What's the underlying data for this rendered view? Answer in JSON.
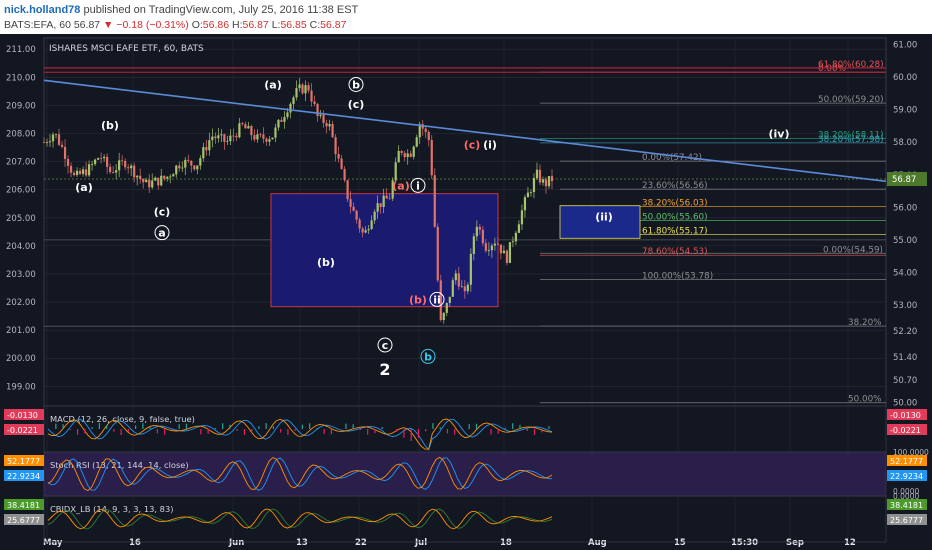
{
  "header": {
    "user": "nick.holland78",
    "published": "published on TradingView.com, July 25, 2016 11:38 EST",
    "symbol": "BATS:EFA, 60",
    "last": "56.87",
    "change": "−0.18 (−0.31%)",
    "open_label": "O:",
    "open": "56.86",
    "high_label": "H:",
    "high": "56.87",
    "low_label": "L:",
    "low": "56.85",
    "close_label": "C:",
    "close": "56.87"
  },
  "colors": {
    "background": "#131722",
    "grid": "#2a2e39",
    "text": "#b2b5be",
    "candle_up": "#a8c46b",
    "candle_down": "#e0736b",
    "trendline": "#5b8bd8",
    "box_fill": "#1a1a6e",
    "box_border": "#c8334b",
    "wave_red": "#ff6b6b",
    "wave_white": "#ffffff",
    "wave_cyan": "#39c6e6"
  },
  "chart_data": {
    "type": "candlestick",
    "title": "ISHARES MSCI EAFE ETF, 60, BATS",
    "left_axis": {
      "ticks": [
        "211.00",
        "210.00",
        "209.00",
        "208.00",
        "207.00",
        "206.00",
        "205.00",
        "204.00",
        "203.00",
        "202.00",
        "201.00",
        "200.00",
        "199.00"
      ],
      "range": [
        198.3,
        211.4
      ]
    },
    "right_axis": {
      "ticks": [
        "61.00",
        "60.00",
        "59.00",
        "58.00",
        "57.00",
        "56.00",
        "55.00",
        "54.00",
        "53.00",
        "52.20",
        "51.40",
        "50.70",
        "50.00"
      ],
      "range": [
        49.9,
        61.2
      ]
    },
    "x_ticks": [
      "May",
      "16",
      "Jun",
      "13",
      "22",
      "Jul",
      "18",
      "Aug",
      "15",
      "15:30",
      "Sep",
      "12"
    ],
    "last_price": "56.87",
    "last_left": "206.00",
    "price_path": [
      {
        "t": 0,
        "v": 58.0
      },
      {
        "t": 0.02,
        "v": 58.3
      },
      {
        "t": 0.04,
        "v": 57.7
      },
      {
        "t": 0.06,
        "v": 56.9
      },
      {
        "t": 0.09,
        "v": 57.2
      },
      {
        "t": 0.11,
        "v": 57.6
      },
      {
        "t": 0.13,
        "v": 57.1
      },
      {
        "t": 0.16,
        "v": 57.4
      },
      {
        "t": 0.2,
        "v": 56.7
      },
      {
        "t": 0.24,
        "v": 56.9
      },
      {
        "t": 0.27,
        "v": 57.4
      },
      {
        "t": 0.3,
        "v": 57.3
      },
      {
        "t": 0.33,
        "v": 58.2
      },
      {
        "t": 0.36,
        "v": 58.0
      },
      {
        "t": 0.39,
        "v": 58.5
      },
      {
        "t": 0.42,
        "v": 58.1
      },
      {
        "t": 0.45,
        "v": 58.2
      },
      {
        "t": 0.48,
        "v": 59.1
      },
      {
        "t": 0.5,
        "v": 59.6
      },
      {
        "t": 0.52,
        "v": 59.7
      },
      {
        "t": 0.54,
        "v": 58.7
      },
      {
        "t": 0.56,
        "v": 58.6
      },
      {
        "t": 0.58,
        "v": 57.4
      },
      {
        "t": 0.6,
        "v": 56.2
      },
      {
        "t": 0.63,
        "v": 55.1
      },
      {
        "t": 0.65,
        "v": 56.0
      },
      {
        "t": 0.68,
        "v": 56.3
      },
      {
        "t": 0.7,
        "v": 57.8
      },
      {
        "t": 0.72,
        "v": 57.6
      },
      {
        "t": 0.74,
        "v": 58.6
      },
      {
        "t": 0.76,
        "v": 58.0
      },
      {
        "t": 0.78,
        "v": 52.4
      },
      {
        "t": 0.79,
        "v": 52.8
      },
      {
        "t": 0.81,
        "v": 54.0
      },
      {
        "t": 0.83,
        "v": 53.2
      },
      {
        "t": 0.85,
        "v": 55.6
      },
      {
        "t": 0.87,
        "v": 54.8
      },
      {
        "t": 0.89,
        "v": 55.0
      },
      {
        "t": 0.91,
        "v": 54.4
      },
      {
        "t": 0.93,
        "v": 55.4
      },
      {
        "t": 0.95,
        "v": 56.3
      },
      {
        "t": 0.97,
        "v": 57.0
      },
      {
        "t": 0.985,
        "v": 56.7
      },
      {
        "t": 1.0,
        "v": 56.87
      }
    ],
    "fib_upper": [
      {
        "label": "61.80%(60.28)",
        "price": 60.28,
        "color": "#e05555"
      },
      {
        "label": "0.00%",
        "price": 60.15,
        "color": "#e05555"
      },
      {
        "label": "50.00%(59.20)",
        "price": 59.2,
        "color": "#8e8e8e"
      },
      {
        "label": "38.20%(58.11)",
        "price": 58.11,
        "color": "#1fa37a"
      },
      {
        "label": "38.20%(57.98)",
        "price": 57.98,
        "color": "#3aa0b8"
      },
      {
        "label": "0.00%(57.42)",
        "price": 57.42,
        "color": "#8e8e8e"
      },
      {
        "label": "23.60%(56.56)",
        "price": 56.56,
        "color": "#8e8e8e"
      },
      {
        "label": "38.20%(56.03)",
        "price": 56.03,
        "color": "#f0a030"
      },
      {
        "label": "50.00%(55.60)",
        "price": 55.6,
        "color": "#5dbf6a"
      },
      {
        "label": "61.80%(55.17)",
        "price": 55.17,
        "color": "#e8e050"
      },
      {
        "label": "78.60%(54.53)",
        "price": 54.53,
        "color": "#e05555"
      },
      {
        "label": "0.00%(54.59)",
        "price": 54.59,
        "color": "#8e8e8e"
      },
      {
        "label": "100.00%(53.78)",
        "price": 53.78,
        "color": "#8e8e8e"
      },
      {
        "label": "38.20%",
        "price": 52.35,
        "color": "#8e8e8e"
      },
      {
        "label": "50.00%",
        "price": 50.0,
        "color": "#8e8e8e"
      }
    ],
    "wave_labels": [
      {
        "text": "(a)",
        "price": 59.65,
        "color": "white",
        "pos": "a1"
      },
      {
        "text": "b",
        "price": 59.65,
        "color": "white",
        "circle": true,
        "pos": "b1"
      },
      {
        "text": "(c)",
        "price": 59.05,
        "color": "white",
        "pos": "c1"
      },
      {
        "text": "(b)",
        "price": 58.4,
        "color": "white",
        "pos": "b2"
      },
      {
        "text": "(a)",
        "price": 56.5,
        "color": "white",
        "pos": "a2"
      },
      {
        "text": "(c)",
        "price": 55.75,
        "color": "white",
        "pos": "c2"
      },
      {
        "text": "a",
        "price": 55.1,
        "color": "white",
        "circle": true,
        "pos": "a3"
      },
      {
        "text": "(b)",
        "price": 54.2,
        "color": "white",
        "pos": "b3"
      },
      {
        "text": "(c)",
        "price": 57.8,
        "color": "red",
        "pos": "c3"
      },
      {
        "text": "(i)",
        "price": 57.8,
        "color": "white",
        "pos": "i1"
      },
      {
        "text": "(a)",
        "price": 56.55,
        "color": "red",
        "pos": "a4"
      },
      {
        "text": "i",
        "price": 56.55,
        "color": "white",
        "circle": true,
        "pos": "i2"
      },
      {
        "text": "(b)",
        "price": 53.05,
        "color": "red",
        "pos": "b4"
      },
      {
        "text": "ii",
        "price": 53.05,
        "color": "white",
        "circle": true,
        "pos": "ii1"
      },
      {
        "text": "c",
        "price": 51.65,
        "color": "white",
        "circle": true,
        "pos": "c4"
      },
      {
        "text": "2",
        "price": 50.85,
        "color": "white",
        "pos": "two"
      },
      {
        "text": "b",
        "price": 51.3,
        "color": "cyan",
        "circle": true,
        "pos": "b5"
      },
      {
        "text": "(iv)",
        "price": 58.15,
        "color": "white",
        "pos": "iv"
      },
      {
        "text": "(ii)",
        "price": 55.6,
        "color": "white",
        "pos": "ii2"
      }
    ],
    "indicators": [
      {
        "name": "MACD (12, 26, close, 9, false, true)",
        "values": [
          "-0.0130",
          "-0.0221"
        ],
        "right_values": [
          "-0.0130",
          "-0.0221"
        ],
        "ticks": []
      },
      {
        "name": "Stoch RSI (13, 21, 144, 14, close)",
        "values": [
          "52.1777",
          "22.9234"
        ],
        "right_values": [
          "52.1777",
          "22.9234"
        ],
        "ticks": [
          "100.0000",
          "0.0000"
        ]
      },
      {
        "name": "CBIDX_LB (14, 9, 3, 3, 13, 83)",
        "values": [
          "38.4181",
          "25.6777"
        ],
        "right_values": [
          "38.4181",
          "25.6777"
        ],
        "ticks": [
          "0.0000"
        ]
      }
    ]
  }
}
